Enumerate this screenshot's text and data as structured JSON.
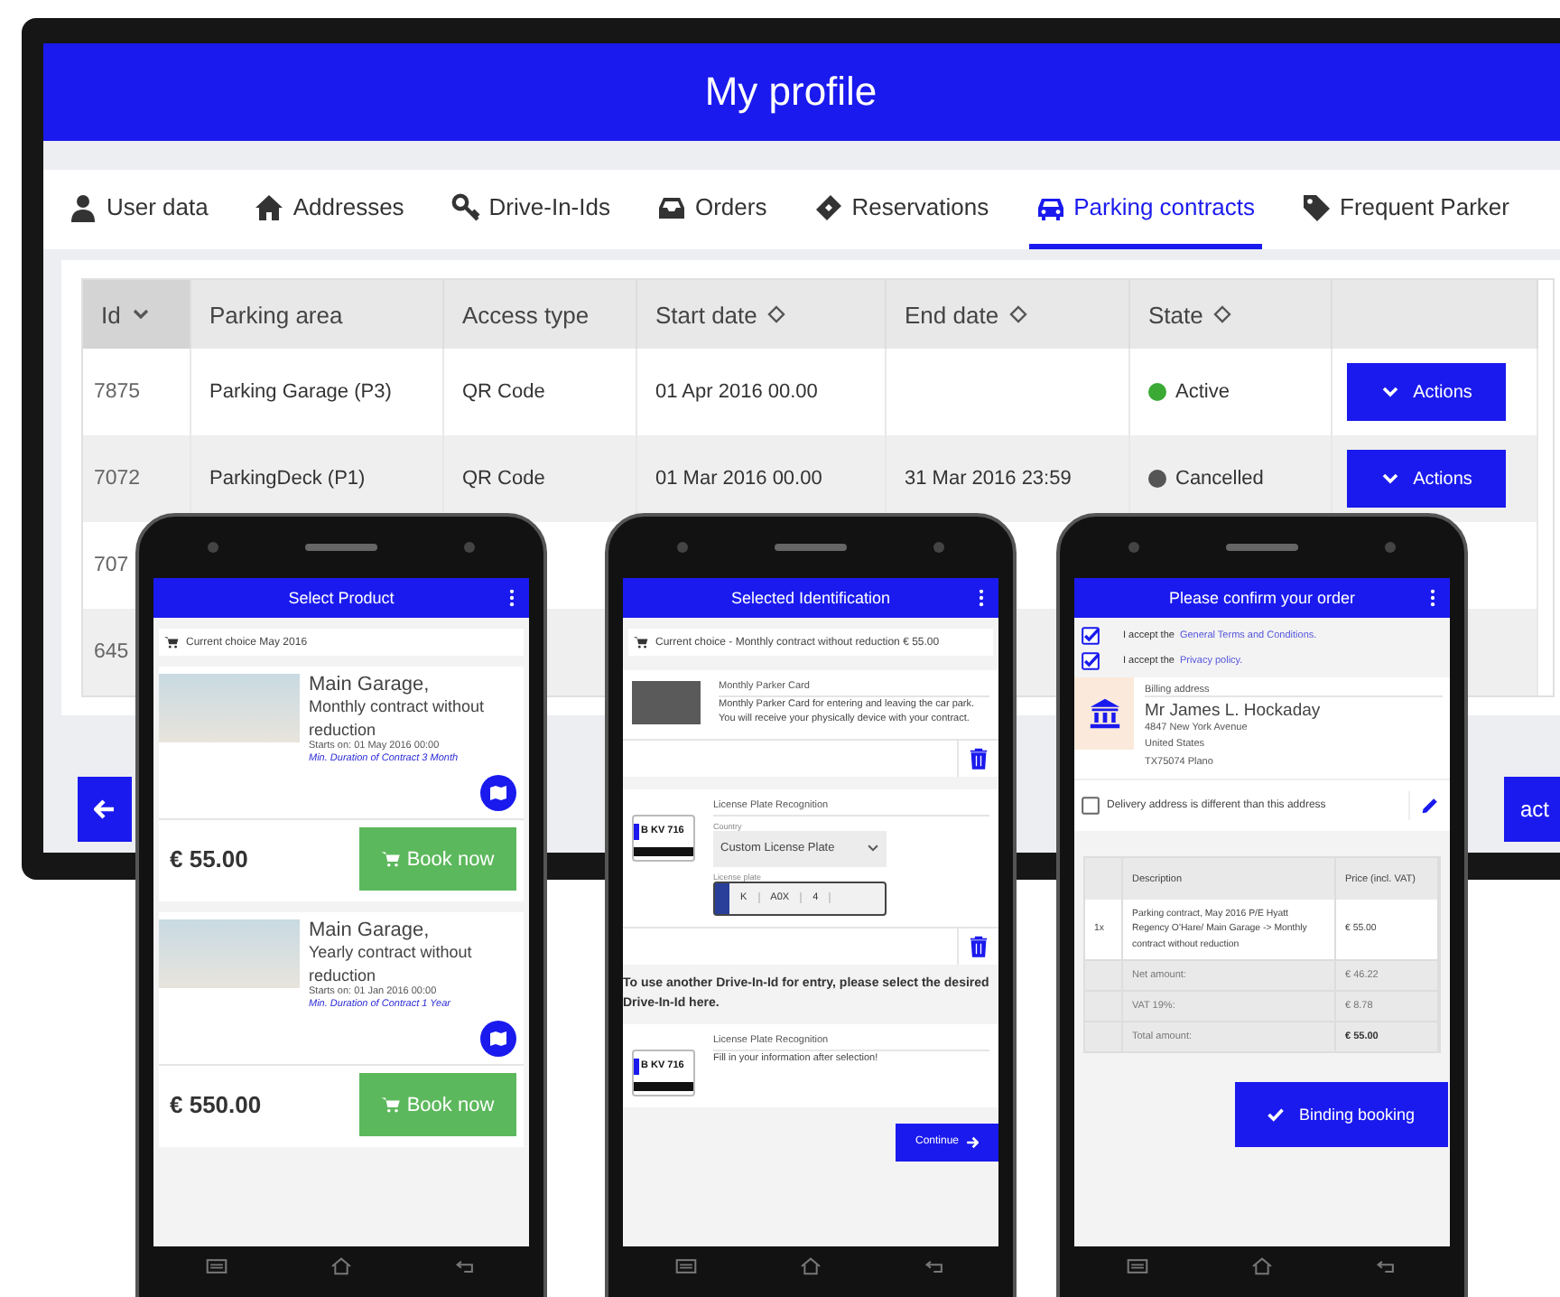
{
  "monitor": {
    "title": "My profile",
    "tabs": [
      {
        "label": "User data",
        "selected": false
      },
      {
        "label": "Addresses",
        "selected": false
      },
      {
        "label": "Drive-In-Ids",
        "selected": false
      },
      {
        "label": "Orders",
        "selected": false
      },
      {
        "label": "Reservations",
        "selected": false
      },
      {
        "label": "Parking contracts",
        "selected": true
      },
      {
        "label": "Frequent Parker",
        "selected": false
      }
    ],
    "columns": [
      {
        "label": "Id",
        "sortable": true,
        "sorted": true
      },
      {
        "label": "Parking area",
        "sortable": false,
        "sorted": false
      },
      {
        "label": "Access type",
        "sortable": false,
        "sorted": false
      },
      {
        "label": "Start date",
        "sortable": true,
        "sorted": false
      },
      {
        "label": "End date",
        "sortable": true,
        "sorted": false
      },
      {
        "label": "State",
        "sortable": true,
        "sorted": false
      }
    ],
    "rows": [
      {
        "id": "7875",
        "parking_area": "Parking Garage (P3)",
        "access_type": "QR Code",
        "start_date": "01 Apr 2016 00.00",
        "state": "Active",
        "color": "#3aaa35",
        "action": "Actions"
      },
      {
        "id": "7072",
        "parking_area": "ParkingDeck (P1)",
        "access_type": "QR Code",
        "start_date": "01 Mar 2016 00.00",
        "end_date": "31 Mar 2016 23:59",
        "state": "Cancelled",
        "color": "#555555",
        "action": "Actions"
      },
      {
        "id": "707"
      },
      {
        "id": "645"
      }
    ],
    "next_button": "act"
  },
  "product_phone": {
    "title": "Select Product",
    "current_choice": "Current choice  May 2016",
    "products": [
      {
        "name": "Main Garage,",
        "description": "Monthly contract without reduction",
        "starts": "Starts on: 01 May 2016 00:00",
        "duration": "Min. Duration of Contract 3 Month",
        "price": "€ 55.00",
        "button": "Book now"
      },
      {
        "name": "Main Garage,",
        "description": "Yearly contract without reduction",
        "starts": "Starts on: 01 Jan 2016 00:00",
        "duration": "Min. Duration of Contract 1 Year",
        "price": "€ 550.00",
        "button": "Book now"
      }
    ]
  },
  "identification_phone": {
    "title": "Selected Identification",
    "current_choice": "Current choice - Monthly contract without reduction € 55.00",
    "card": {
      "title": "Monthly Parker Card",
      "description": "Monthly Parker Card for entering and leaving the car park. You will receive your physically device with your contract."
    },
    "plate_card": {
      "plate": "B KV 716",
      "title": "License Plate Recognition",
      "country_label": "Country",
      "country": "Custom License Plate",
      "plate_label": "License plate",
      "plate_parts": [
        "K",
        "A0X",
        "4"
      ]
    },
    "hint": "To use another Drive-In-Id for entry, please select the desired Drive-In-Id here.",
    "option": {
      "plate": "B KV 716",
      "title": "License Plate Recognition",
      "description": "Fill in your information after selection!"
    },
    "button": "Continue"
  },
  "confirm_phone": {
    "title": "Please confirm your order",
    "consents": [
      {
        "text": "I accept the",
        "link": "General Terms and Conditions.",
        "checked": true
      },
      {
        "text": "I accept the",
        "link": "Privacy policy.",
        "checked": true
      }
    ],
    "billing": {
      "label": "Billing address",
      "name": "Mr James L. Hockaday",
      "lines": [
        "4847 New York Avenue",
        "United States",
        "TX75074 Plano"
      ]
    },
    "delivery": {
      "label": "Delivery address is different than this address",
      "checked": false
    },
    "table": {
      "columns": [
        "Description",
        "Price (incl. VAT)"
      ],
      "item": {
        "quantity": "1x",
        "description": "Parking contract, May 2016 P/E Hyatt Regency O'Hare/ Main Garage -> Monthly contract without reduction",
        "price": "€ 55.00"
      },
      "totals": [
        {
          "label": "Net amount:",
          "value": "€ 46.22",
          "bold": false
        },
        {
          "label": "VAT 19%:",
          "value": "€ 8.78",
          "bold": false
        },
        {
          "label": "Total amount:",
          "value": "€ 55.00",
          "bold": true
        }
      ]
    },
    "button": "Binding booking"
  }
}
